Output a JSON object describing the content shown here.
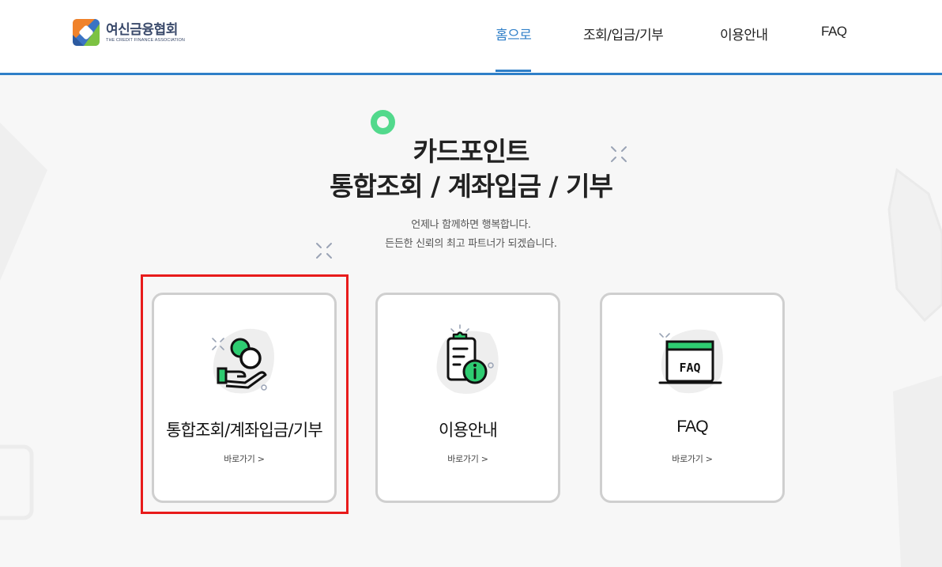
{
  "header": {
    "logo_ko": "여신금융협회",
    "logo_en": "THE CREDIT FINANCE ASSOCIATION",
    "nav": [
      "홈으로",
      "조회/입금/기부",
      "이용안내",
      "FAQ"
    ]
  },
  "hero": {
    "title_line1": "카드포인트",
    "title_line2": "통합조회 / 계좌입금 / 기부",
    "sub_line1": "언제나 함께하면 행복합니다.",
    "sub_line2": "든든한 신뢰의 최고 파트너가 되겠습니다."
  },
  "cards": [
    {
      "title": "통합조회/계좌입금/기부",
      "link": "바로가기 >",
      "icon": "coin-hand-icon"
    },
    {
      "title": "이용안내",
      "link": "바로가기 >",
      "icon": "clipboard-info-icon"
    },
    {
      "title": "FAQ",
      "link": "바로가기 >",
      "icon": "faq-window-icon",
      "icon_text": "FAQ"
    }
  ],
  "colors": {
    "accent": "#2f7fc8",
    "green": "#2ecc71",
    "highlight": "#e81b1b"
  }
}
